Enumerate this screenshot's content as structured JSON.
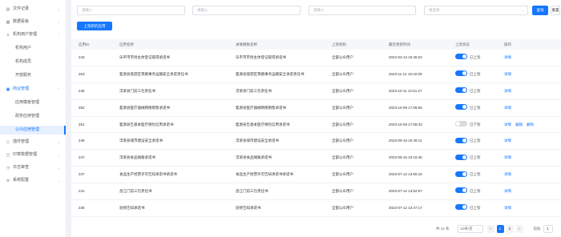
{
  "sidebar": {
    "items": [
      {
        "label": "文件记录",
        "caret": "⌄"
      },
      {
        "label": "数据看板",
        "caret": "⌄"
      },
      {
        "label": "机构用户管理",
        "caret": "⌃"
      },
      {
        "label": "机构用户"
      },
      {
        "label": "机构成员"
      },
      {
        "label": "开放服务"
      },
      {
        "label": "商业管理",
        "caret": "⌃"
      },
      {
        "label": "应用模板管理"
      },
      {
        "label": "政务应用管理"
      },
      {
        "label": "公众应用管理"
      },
      {
        "label": "插件管理",
        "caret": "⌄"
      },
      {
        "label": "印章数据管理",
        "caret": "⌄"
      },
      {
        "label": "日志审查",
        "caret": "⌄"
      },
      {
        "label": "系统配置",
        "caret": "⌄"
      }
    ]
  },
  "filters": {
    "placeholder_input": "请输入",
    "placeholder_select": "请选择",
    "search_label": "查询",
    "reset_label": "重置"
  },
  "toolbar": {
    "add_label": "上架新的应用"
  },
  "table": {
    "headers": [
      "应用ID",
      "应用名称",
      "关联模板名称",
      "上架机构",
      "最近更新时间",
      "上架状态",
      "操作"
    ],
    "rows": [
      {
        "id": "243",
        "name": "乐平市市场主体登记取得承诺书",
        "tpl": "乐平市市场主体登记取得承诺书",
        "owner": "全部公众用户",
        "time": "2024-03-13 10:46:04",
        "on": true,
        "state": "已上架",
        "ops": [
          "详情"
        ]
      },
      {
        "id": "253",
        "name": "婺源县旅游区茶路事务运输安全承诺责任书",
        "tpl": "婺源县旅游区茶路事务运输安全承诺责任书",
        "owner": "全部公众用户",
        "time": "2023-11-14 15:42:09",
        "on": true,
        "state": "已上架",
        "ops": [
          "详情"
        ]
      },
      {
        "id": "246",
        "name": "浮梁县门前三包责任书",
        "tpl": "浮梁县门前三包责任书",
        "owner": "全部公众用户",
        "time": "2023-10-11 12:51:27",
        "on": true,
        "state": "已上架",
        "ops": [
          "详情"
        ]
      },
      {
        "id": "252",
        "name": "婺源县医疗器械网络销售承诺书",
        "tpl": "婺源县医疗器械网络销售承诺书",
        "owner": "全部公众用户",
        "time": "2023-10-09 17:09:05",
        "on": true,
        "state": "已上架",
        "ops": [
          "详情"
        ]
      },
      {
        "id": "251",
        "name": "婺源县告基本医疗保险信用承诺书",
        "tpl": "婺源县告基本医疗保险信用承诺书",
        "owner": "全部公众用户",
        "time": "2023-10-09 17:08:43",
        "on": false,
        "state": "已下架",
        "ops": [
          "详情",
          "编辑",
          "删除"
        ]
      },
      {
        "id": "249",
        "name": "浮梁县城市建设安全承诺书",
        "tpl": "浮梁县城市建设安全承诺书",
        "owner": "全部公众用户",
        "time": "2023-09-18 10:49:11",
        "on": true,
        "state": "已上架",
        "ops": [
          "详情"
        ]
      },
      {
        "id": "247",
        "name": "浮梁县食品摊贩承诺书",
        "tpl": "浮梁县食品摊贩承诺书",
        "owner": "全部公众用户",
        "time": "2023-09-15 10:16:46",
        "on": true,
        "state": "已上架",
        "ops": [
          "详情"
        ]
      },
      {
        "id": "237",
        "name": "食品生产经营许可告知承诺书承诺书",
        "tpl": "食品生产经营许可告知承诺书承诺书",
        "owner": "全部公众用户",
        "time": "2023-07-12 13:55:16",
        "on": true,
        "state": "已上架",
        "ops": [
          "详情"
        ]
      },
      {
        "id": "241",
        "name": "昌江门前三包责任书",
        "tpl": "昌江门前三包责任书",
        "owner": "全部公众用户",
        "time": "2023-07-12 13:52:57",
        "on": true,
        "state": "已上架",
        "ops": [
          "详情"
        ]
      },
      {
        "id": "236",
        "name": "验修告知承诺书",
        "tpl": "验修告知承诺书",
        "owner": "全部公众用户",
        "time": "2023-07-12 13:47:17",
        "on": true,
        "state": "已上架",
        "ops": [
          "详情"
        ]
      }
    ]
  },
  "pagination": {
    "total": "共 12 条",
    "page_size": "10条/页",
    "prev": "<",
    "pages": [
      "1",
      "2"
    ],
    "next": ">",
    "goto_label": "前往",
    "goto_value": "1"
  },
  "colors": {
    "accent": "#1677ff"
  }
}
